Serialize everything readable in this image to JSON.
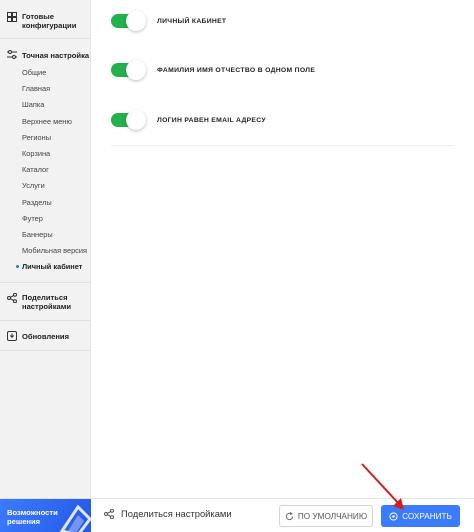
{
  "sidebar": {
    "ready_configs": "Готовые конфигурации",
    "fine_tuning": "Точная настройка",
    "items": [
      {
        "label": "Общие"
      },
      {
        "label": "Главная"
      },
      {
        "label": "Шапка"
      },
      {
        "label": "Верхнее меню"
      },
      {
        "label": "Регионы"
      },
      {
        "label": "Корзина"
      },
      {
        "label": "Каталог"
      },
      {
        "label": "Услуги"
      },
      {
        "label": "Разделы"
      },
      {
        "label": "Футер"
      },
      {
        "label": "Баннеры"
      },
      {
        "label": "Мобильная версия"
      },
      {
        "label": "Личный кабинет",
        "active": true
      }
    ],
    "share_settings": "Поделиться настройками",
    "updates": "Обновления"
  },
  "settings": [
    {
      "label": "ЛИЧНЫЙ КАБИНЕТ",
      "enabled": true
    },
    {
      "label": "ФАМИЛИЯ ИМЯ ОТЧЕСТВО В ОДНОМ ПОЛЕ",
      "enabled": true
    },
    {
      "label": "ЛОГИН РАВЕН EMAIL АДРЕСУ",
      "enabled": true
    }
  ],
  "footer": {
    "promo": "Возможности решения",
    "share": "Поделиться настройками",
    "default_btn": "ПО УМОЛЧАНИЮ",
    "save_btn": "СОХРАНИТЬ"
  },
  "colors": {
    "toggle_on": "#22b14c",
    "accent": "#3b7bff",
    "annotation_arrow": "#d11f1f"
  }
}
